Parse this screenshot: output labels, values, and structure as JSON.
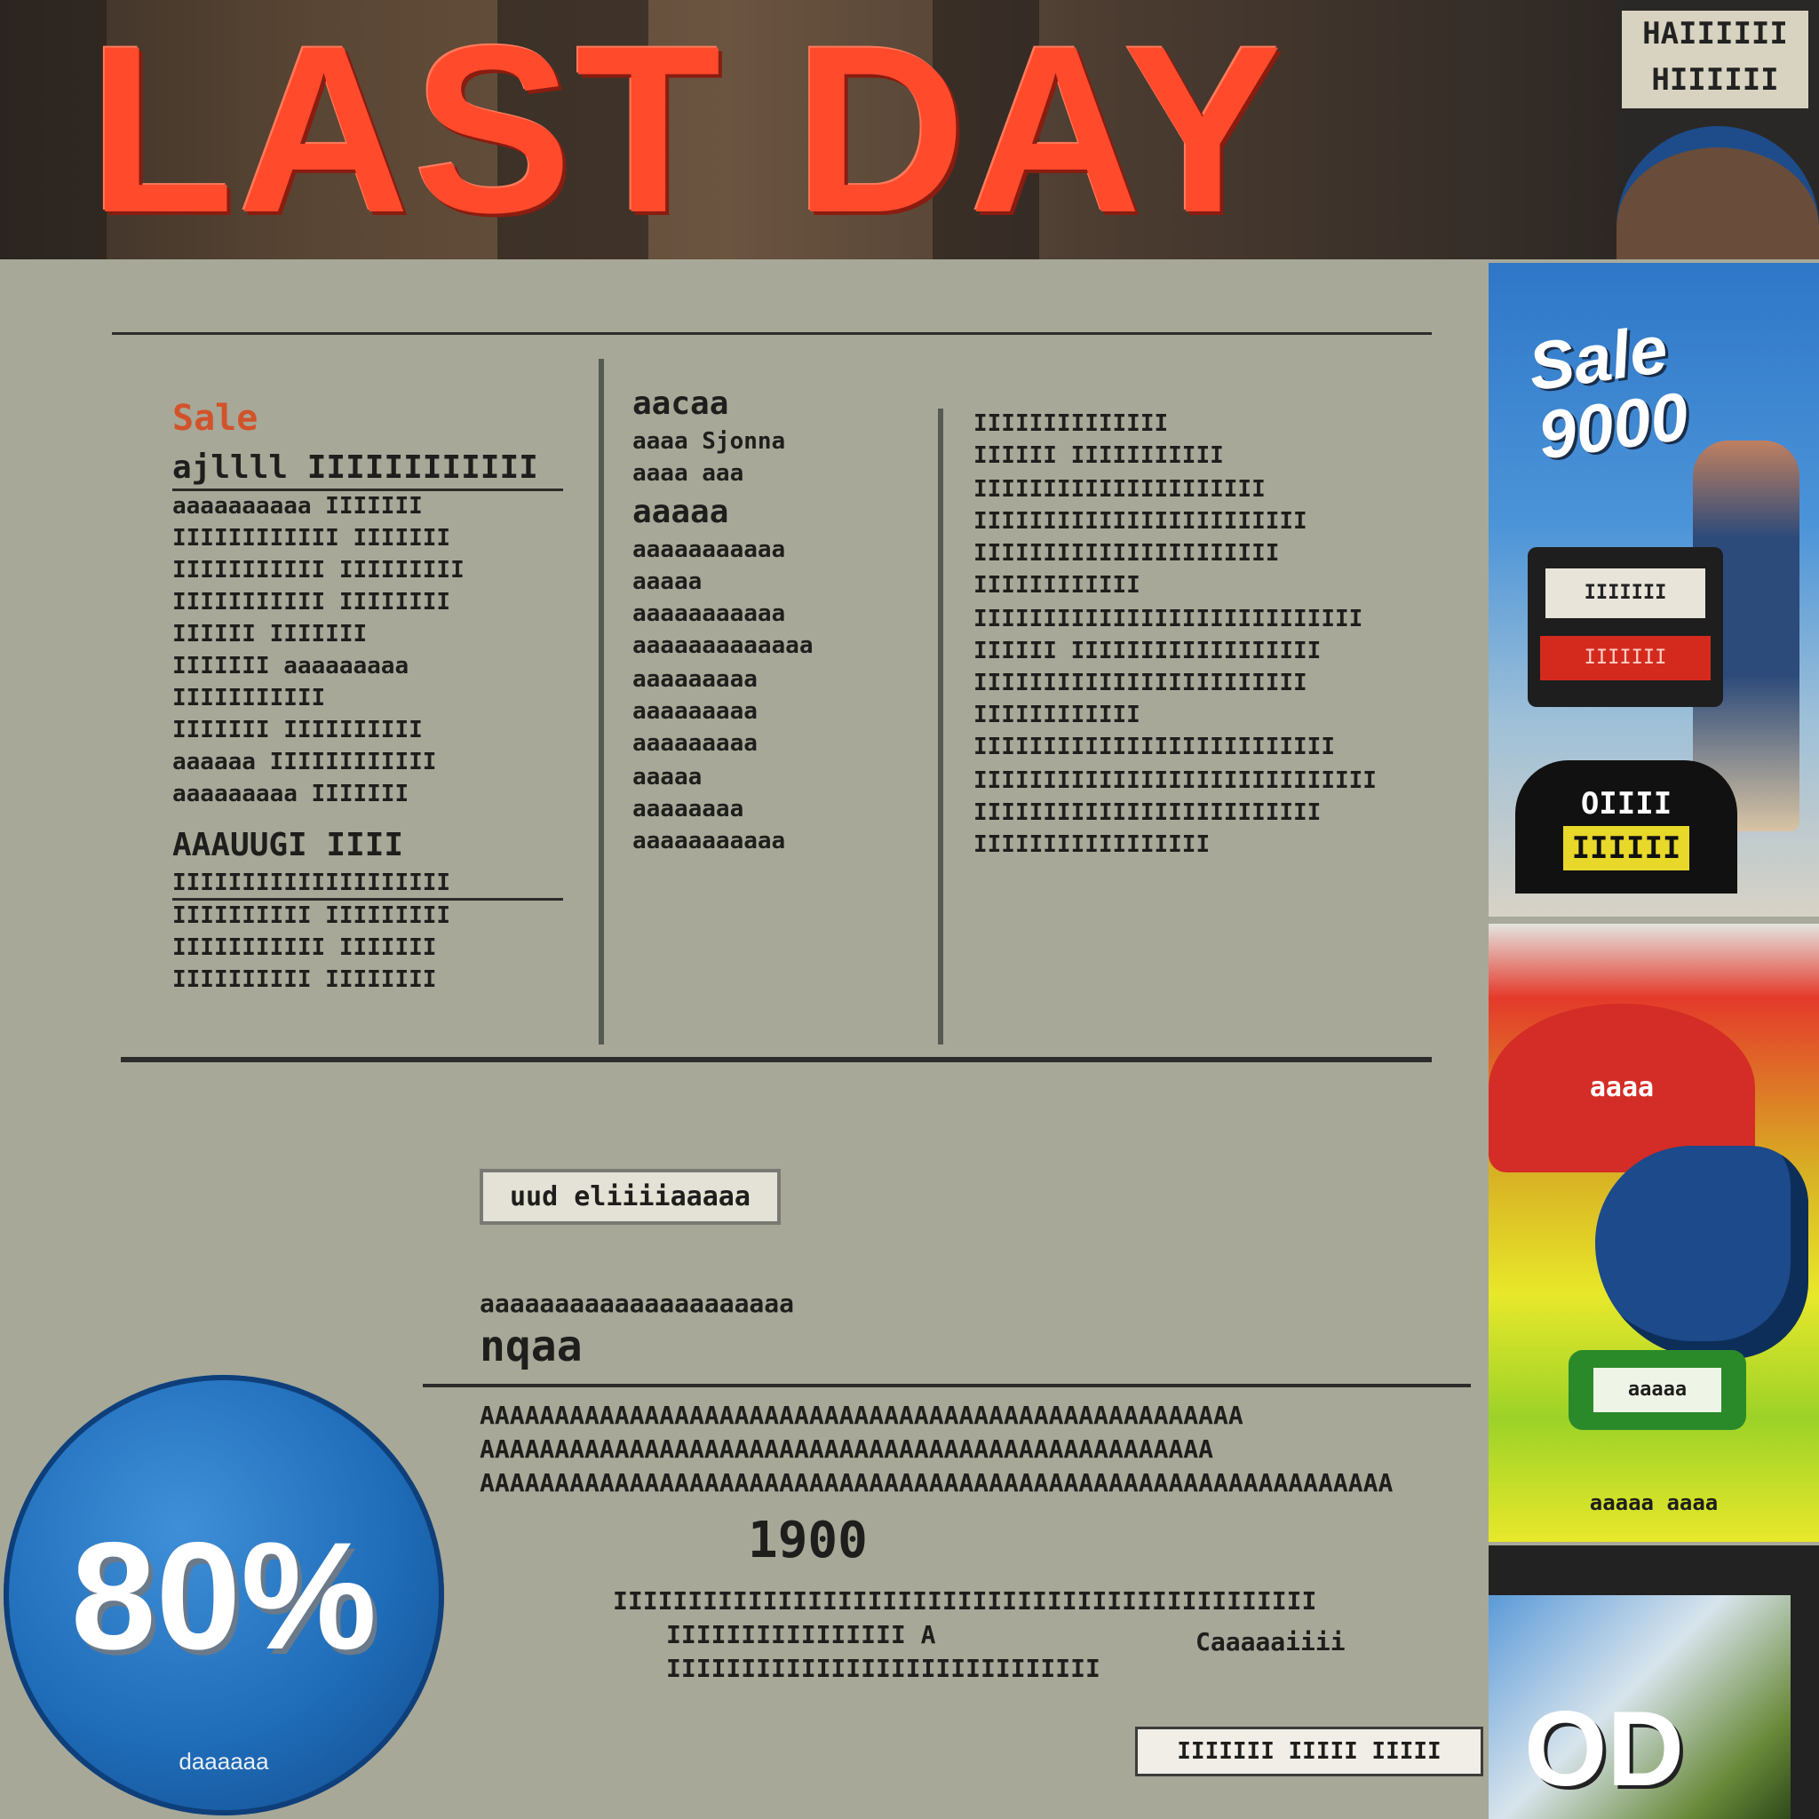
{
  "banner": {
    "title": "LAST DAY",
    "sign_text": "HAIIIIII\nHIIIIII"
  },
  "paper": {
    "col1": {
      "head": "Sale",
      "lines": [
        "ajllll IIIIIIIIIIII",
        "aaaaaaaaaa IIIIIII",
        "IIIIIIIIIIII IIIIIII",
        "IIIIIIIIIII IIIIIIIII",
        "IIIIIIIIIII IIIIIIII",
        "IIIIII IIIIIII",
        "IIIIIII aaaaaaaaa",
        "IIIIIIIIIII",
        "IIIIIII IIIIIIIIII",
        "aaaaaa IIIIIIIIIIII",
        "aaaaaaaaa IIIIIII"
      ],
      "head2": "AAAUUGI IIII",
      "lines2": [
        "IIIIIIIIIIIIIIIIIIII",
        "IIIIIIIIII IIIIIIIII",
        "IIIIIIIIIII IIIIIII",
        "IIIIIIIIII IIIIIIII"
      ]
    },
    "col2": {
      "lines": [
        "aacaa",
        "aaaa Sjonna",
        "aaaa aaa",
        "",
        "aaaaa",
        "aaaaaaaaaaa",
        "aaaaa",
        "aaaaaaaaaaa",
        "aaaaaaaaaaaaa",
        "",
        "aaaaaaaaa",
        "aaaaaaaaa",
        "aaaaaaaaa",
        "",
        "aaaaa",
        "aaaaaaaa",
        "aaaaaaaaaaa"
      ]
    },
    "col3": {
      "lines": [
        "IIIIIIIIIIIIII",
        "IIIIII IIIIIIIIIII",
        "",
        "IIIIIIIIIIIIIIIIIIIII",
        "IIIIIIIIIIIIIIIIIIIIIIII",
        "IIIIIIIIIIIIIIIIIIIIII",
        "IIIIIIIIIIII",
        "",
        "IIIIIIIIIIIIIIIIIIIIIIIIIIII",
        "IIIIII IIIIIIIIIIIIIIIIII",
        "IIIIIIIIIIIIIIIIIIIIIIII",
        "IIIIIIIIIIII",
        "IIIIIIIIIIIIIIIIIIIIIIIIII",
        "",
        "IIIIIIIIIIIIIIIIIIIIIIIIIIIII",
        "IIIIIIIIIIIIIIIIIIIIIIIII",
        "IIIIIIIIIIIIIIIII"
      ]
    },
    "lower": {
      "tab": "uud eliiiiaaaaa",
      "lines": [
        "aaaaaaaaaaaaaaaaaaaaa",
        "",
        "AAAAAAAAAAAAAAAAAAAAAAAAAAAAAAAAAAAAAAAAAAAAAAAAAAA",
        "AAAAAAAAAAAAAAAAAAAAAAAAAAAAAAAAAAAAAAAAAAAAAAAAA",
        "AAAAAAAAAAAAAAAAAAAAAAAAAAAAAAAAAAAAAAAAAAAAAAAAAAAAAAAAAAAAA"
      ],
      "big": "nqaa",
      "price": "1900",
      "under_price": [
        "IIIIIIIIIIIIIIIIIIIIIIIIIIIIIIIIIIIIIIIIIIIIIII",
        "IIIIIIIIIIIIIIII A",
        "IIIIIIIIIIIIIIIIIIIIIIIIIIIII"
      ],
      "side_note": "Caaaaaiiii",
      "footer": "IIIIIII IIIII IIIII"
    }
  },
  "badge": {
    "text": "80%",
    "sub": "daaaaaa"
  },
  "side": {
    "ad1": {
      "title": "Sale 9000",
      "box_label": "IIIIIII",
      "box_red": "IIIIIII",
      "foot_top": "OIIII",
      "foot_bottom": "IIIIII"
    },
    "ad2": {
      "hat": "aaaa",
      "badge": "aaaaa",
      "caption": "aaaaa aaaa"
    },
    "ad3": {
      "text": "OD"
    }
  },
  "colors": {
    "title_red": "#ff4a2c",
    "badge_blue": "#1f6cb8",
    "paper": "#a7a898"
  }
}
